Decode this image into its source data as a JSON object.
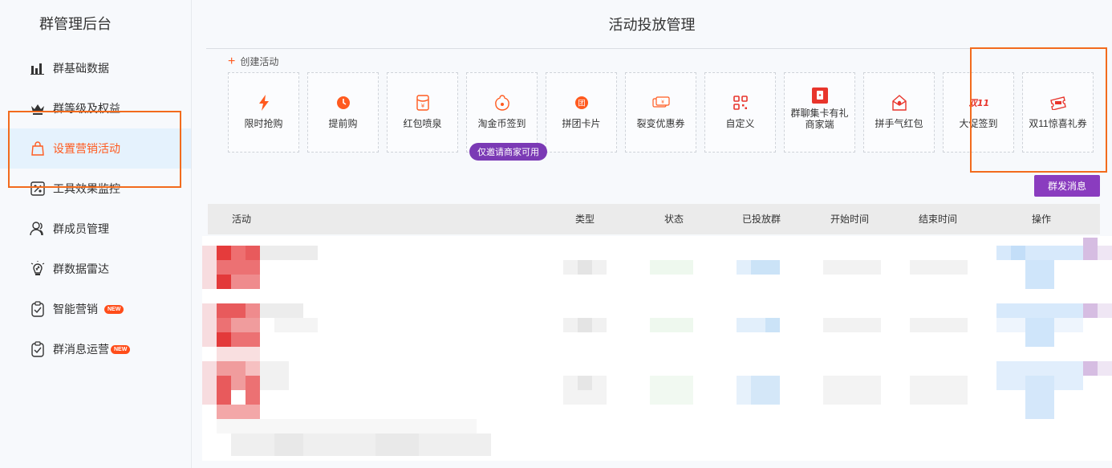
{
  "sidebar": {
    "brand": "群管理后台",
    "items": [
      {
        "label": "群基础数据",
        "icon": "bar-chart-icon"
      },
      {
        "label": "群等级及权益",
        "icon": "crown-icon"
      },
      {
        "label": "设置营销活动",
        "icon": "shopping-bag-icon",
        "active": true
      },
      {
        "label": "工具效果监控",
        "icon": "monitor-icon"
      },
      {
        "label": "群成员管理",
        "icon": "users-icon"
      },
      {
        "label": "群数据雷达",
        "icon": "radar-bulb-icon"
      },
      {
        "label": "智能营销",
        "icon": "clipboard-check-icon",
        "badge": "NEW"
      },
      {
        "label": "群消息运营",
        "icon": "clipboard-check-icon",
        "badge": "NEW"
      }
    ]
  },
  "main": {
    "title": "活动投放管理",
    "create_label": "创建活动",
    "cards": [
      {
        "label": "限时抢购",
        "icon": "lightning-icon"
      },
      {
        "label": "提前购",
        "icon": "clock-icon"
      },
      {
        "label": "红包喷泉",
        "icon": "red-packet-icon"
      },
      {
        "label": "淘金币签到",
        "icon": "coin-icon"
      },
      {
        "label": "拼团卡片",
        "icon": "group-icon"
      },
      {
        "label": "裂变优惠券",
        "icon": "coupon-icon"
      },
      {
        "label": "自定义",
        "icon": "qr-grid-icon"
      },
      {
        "label": "群聊集卡有礼商家端",
        "icon": "card-collect-icon"
      },
      {
        "label": "拼手气红包",
        "icon": "lucky-packet-icon"
      },
      {
        "label": "大促签到",
        "icon": "double11-icon"
      },
      {
        "label": "双11惊喜礼券",
        "icon": "gift-ticket-icon"
      }
    ],
    "invite_note": "仅邀请商家可用",
    "send_button": "群发消息",
    "table_headers": [
      "活动",
      "类型",
      "状态",
      "已投放群",
      "开始时间",
      "结束时间",
      "操作"
    ]
  },
  "colors": {
    "accent": "#ff5a1f",
    "purple": "#8a3cbf",
    "highlight_box": "#f26b1d",
    "active_bg": "#e5f2fd"
  }
}
